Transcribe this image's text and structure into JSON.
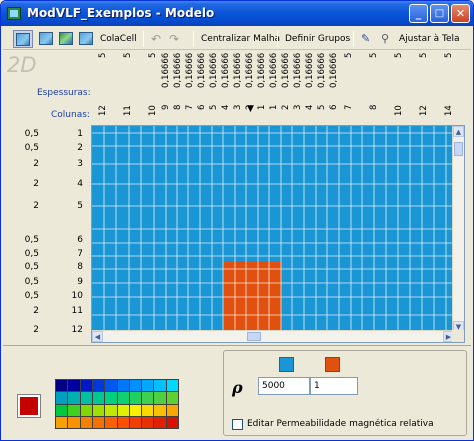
{
  "window": {
    "title": "ModVLF_Exemplos - Modelo",
    "buttons": {
      "minimize": "_",
      "maximize": "□",
      "close": "✕"
    }
  },
  "toolbar": {
    "colacell": "ColaCell",
    "centralizar": "Centralizar Malha",
    "definir": "Definir Grupos",
    "ajustar": "Ajustar à Tela"
  },
  "view_label": "2D",
  "headers": {
    "espessuras": "Espessuras:",
    "colunas": "Colunas:"
  },
  "columns": [
    {
      "espessura": "5",
      "coluna": "12"
    },
    {
      "espessura": "5",
      "coluna": "11"
    },
    {
      "espessura": "5",
      "coluna": "10"
    },
    {
      "espessura": "0,16666",
      "coluna": "9"
    },
    {
      "espessura": "0,16666",
      "coluna": "8"
    },
    {
      "espessura": "0,16666",
      "coluna": "7"
    },
    {
      "espessura": "0,16666",
      "coluna": "6"
    },
    {
      "espessura": "0,16666",
      "coluna": "5"
    },
    {
      "espessura": "0,16666",
      "coluna": "4"
    },
    {
      "espessura": "0,16666",
      "coluna": "3"
    },
    {
      "espessura": "0,16666",
      "coluna": "2"
    },
    {
      "espessura": "0,16666",
      "coluna": "1"
    },
    {
      "espessura": "0,16666",
      "coluna": "1"
    },
    {
      "espessura": "0,16666",
      "coluna": "2"
    },
    {
      "espessura": "0,16666",
      "coluna": "3"
    },
    {
      "espessura": "0,16666",
      "coluna": "4"
    },
    {
      "espessura": "0,16666",
      "coluna": "5"
    },
    {
      "espessura": "0,16666",
      "coluna": "6"
    },
    {
      "espessura": "5",
      "coluna": "7"
    },
    {
      "espessura": "5",
      "coluna": "8"
    },
    {
      "espessura": "5",
      "coluna": "10"
    },
    {
      "espessura": "5",
      "coluna": "12"
    },
    {
      "espessura": "5",
      "coluna": "14"
    }
  ],
  "rows": [
    {
      "espessura": "0,5",
      "linha": "1"
    },
    {
      "espessura": "0,5",
      "linha": "2"
    },
    {
      "espessura": "2",
      "linha": "3"
    },
    {
      "espessura": "2",
      "linha": "4"
    },
    {
      "espessura": "2",
      "linha": "5"
    },
    {
      "espessura": "0,5",
      "linha": "6"
    },
    {
      "espessura": "0,5",
      "linha": "7"
    },
    {
      "espessura": "0,5",
      "linha": "8"
    },
    {
      "espessura": "0,5",
      "linha": "9"
    },
    {
      "espessura": "0,5",
      "linha": "10"
    },
    {
      "espessura": "2",
      "linha": "11"
    },
    {
      "espessura": "2",
      "linha": "12"
    }
  ],
  "grid_colors": {
    "background": "#1a96d4",
    "selected": "#e0500f",
    "lines": "#ffffff"
  },
  "properties": {
    "group1_color": "#1a96d4",
    "group2_color": "#e0500f",
    "value1": "5000",
    "value2": "1",
    "checkbox_label": "Editar Permeabilidade magnética relativa"
  },
  "current_color": "#c40000",
  "palette_rows": [
    [
      "#000080",
      "#0000a0",
      "#0018c8",
      "#0038e0",
      "#0058f0",
      "#0078f8",
      "#0090ff",
      "#00a8ff",
      "#00c0ff",
      "#00d8ff"
    ],
    [
      "#00a0c0",
      "#00b0b0",
      "#00c0a0",
      "#00c890",
      "#00d080",
      "#10d070",
      "#20d060",
      "#40d050",
      "#50d040",
      "#60d030"
    ],
    [
      "#00c840",
      "#40d020",
      "#80d800",
      "#a0e000",
      "#c0e800",
      "#e0f000",
      "#f8f000",
      "#f8d800",
      "#f8c000",
      "#f8a800"
    ],
    [
      "#f8a000",
      "#f89000",
      "#f88000",
      "#f87000",
      "#f86000",
      "#f85000",
      "#f04000",
      "#e83000",
      "#e02000",
      "#d81000"
    ]
  ]
}
